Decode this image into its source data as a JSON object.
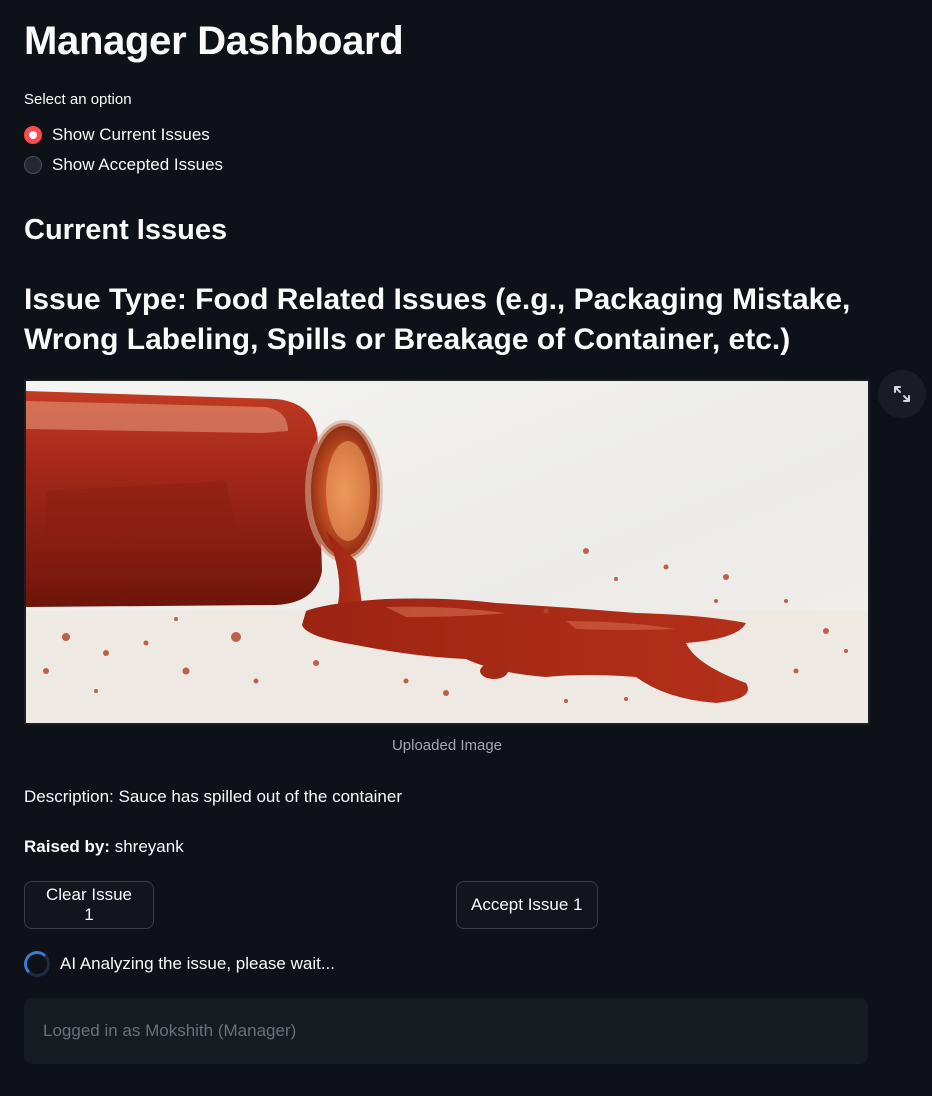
{
  "page": {
    "title": "Manager Dashboard"
  },
  "options": {
    "caption": "Select an option",
    "items": [
      {
        "label": "Show Current Issues",
        "selected": true
      },
      {
        "label": "Show Accepted Issues",
        "selected": false
      }
    ]
  },
  "section": {
    "heading": "Current Issues"
  },
  "issue": {
    "type_heading": "Issue Type: Food Related Issues (e.g., Packaging Mistake, Wrong Labeling, Spills or Breakage of Container, etc.)",
    "image_caption": "Uploaded Image",
    "description": "Description: Sauce has spilled out of the container",
    "raised_by_label": "Raised by:",
    "raised_by_value": "shreyank",
    "clear_button": "Clear Issue 1",
    "accept_button": "Accept Issue 1"
  },
  "spinner": {
    "text": "AI Analyzing the issue, please wait..."
  },
  "footer": {
    "status": "Logged in as Mokshith (Manager)"
  },
  "colors": {
    "background": "#0e1117",
    "accent": "#ff4b4b",
    "spinner": "#3a7bd5"
  },
  "icons": {
    "expand": "fullscreen-expand-icon"
  }
}
